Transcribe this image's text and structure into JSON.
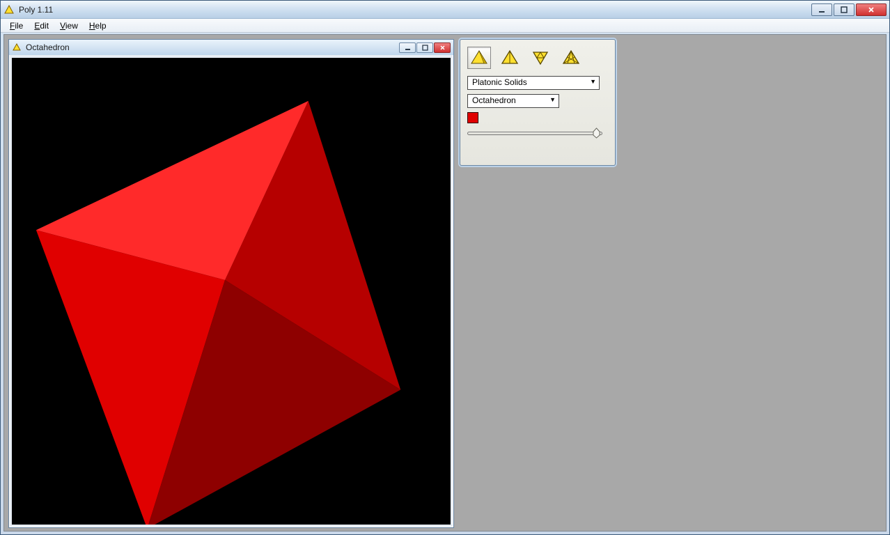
{
  "app": {
    "title": "Poly 1.11"
  },
  "menu": {
    "file": "File",
    "edit": "Edit",
    "view": "View",
    "help": "Help"
  },
  "viewer": {
    "title": "Octahedron"
  },
  "panel": {
    "category": "Platonic Solids",
    "solid": "Octahedron",
    "color": "#e00000",
    "slider_value": 0.97,
    "modes": {
      "solid": "view-solid-icon",
      "net": "view-net-icon",
      "dual": "view-dual-icon",
      "wire": "view-wire-icon"
    }
  }
}
